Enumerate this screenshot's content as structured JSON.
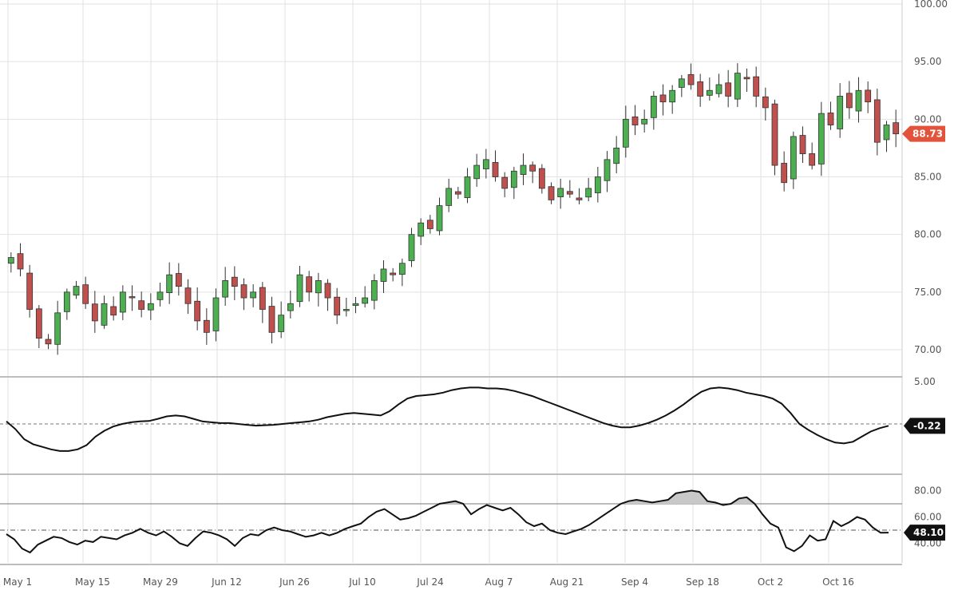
{
  "chart_data": [
    {
      "type": "candlestick",
      "panel": "price",
      "title": "",
      "ylim": [
        70,
        100
      ],
      "y_ticks": [
        "70.00",
        "75.00",
        "80.00",
        "85.00",
        "90.00",
        "95.00",
        "100.00"
      ],
      "grid": true,
      "last_value_label": "88.73",
      "colors": {
        "up": "#4caf50",
        "down": "#c0504d",
        "badge": "#e2533b"
      },
      "x_labels": [
        "May 1",
        "May 15",
        "May 29",
        "Jun 12",
        "Jun 26",
        "Jul 10",
        "Jul 24",
        "Aug 7",
        "Aug 21",
        "Sep 4",
        "Sep 18",
        "Oct 2",
        "Oct 16"
      ],
      "closes": [
        78.0,
        77.0,
        73.5,
        71.0,
        70.5,
        73.2,
        75.0,
        75.5,
        74.0,
        72.5,
        74.0,
        73.0,
        75.0,
        74.5,
        73.5,
        74.0,
        75.0,
        76.5,
        75.5,
        74.0,
        72.5,
        71.5,
        74.5,
        76.0,
        75.5,
        74.5,
        75.0,
        73.5,
        71.5,
        73.0,
        74.0,
        76.5,
        75.0,
        76.0,
        74.5,
        73.0,
        73.5,
        74.0,
        74.5,
        76.0,
        77.0,
        76.5,
        77.5,
        80.0,
        81.0,
        80.5,
        82.5,
        84.0,
        83.5,
        85.0,
        86.0,
        86.5,
        85.0,
        84.0,
        85.5,
        86.0,
        85.5,
        84.0,
        83.0,
        84.0,
        83.5,
        83.0,
        84.0,
        85.0,
        86.5,
        87.5,
        90.0,
        89.5,
        90.0,
        92.0,
        91.5,
        92.5,
        93.5,
        93.0,
        92.0,
        92.5,
        93.0,
        92.0,
        94.0,
        93.5,
        92.0,
        91.0,
        86.0,
        84.5,
        88.5,
        87.0,
        86.0,
        90.5,
        89.5,
        92.0,
        91.0,
        92.5,
        91.5,
        88.0,
        89.5,
        88.73
      ]
    },
    {
      "type": "line",
      "panel": "oscillator",
      "ylim": [
        -5,
        5
      ],
      "y_ticks": [
        "5.00"
      ],
      "baseline": 0,
      "last_value_label": "-0.22",
      "values": [
        0.3,
        -0.6,
        -1.8,
        -2.4,
        -2.7,
        -3.0,
        -3.2,
        -3.2,
        -3.0,
        -2.5,
        -1.5,
        -0.8,
        -0.3,
        0.0,
        0.2,
        0.3,
        0.35,
        0.6,
        0.9,
        1.0,
        0.9,
        0.6,
        0.3,
        0.2,
        0.1,
        0.1,
        0.0,
        -0.1,
        -0.2,
        -0.15,
        -0.1,
        0.0,
        0.1,
        0.2,
        0.3,
        0.5,
        0.8,
        1.0,
        1.2,
        1.3,
        1.2,
        1.1,
        1.0,
        1.5,
        2.3,
        3.0,
        3.3,
        3.4,
        3.5,
        3.7,
        4.0,
        4.2,
        4.3,
        4.3,
        4.2,
        4.2,
        4.1,
        3.9,
        3.6,
        3.3,
        2.9,
        2.5,
        2.1,
        1.7,
        1.3,
        0.9,
        0.5,
        0.1,
        -0.2,
        -0.4,
        -0.4,
        -0.2,
        0.1,
        0.5,
        1.0,
        1.6,
        2.3,
        3.1,
        3.8,
        4.2,
        4.3,
        4.2,
        4.0,
        3.7,
        3.5,
        3.3,
        3.0,
        2.4,
        1.3,
        0.0,
        -0.7,
        -1.3,
        -1.8,
        -2.2,
        -2.3,
        -2.1,
        -1.5,
        -0.9,
        -0.5,
        -0.22
      ]
    },
    {
      "type": "area",
      "panel": "rsi",
      "ylim": [
        30,
        90
      ],
      "y_ticks": [
        "40.00",
        "60.00",
        "80.00"
      ],
      "upper_level": 70,
      "mid_level": 50,
      "last_value_label": "48.10",
      "values": [
        47,
        43,
        36,
        33,
        39,
        42,
        45,
        44,
        41,
        39,
        42,
        41,
        45,
        44,
        43,
        46,
        48,
        51,
        48,
        46,
        49,
        45,
        40,
        38,
        44,
        49,
        48,
        46,
        43,
        38,
        44,
        47,
        46,
        50,
        52,
        50,
        49,
        47,
        45,
        46,
        48,
        46,
        48,
        51,
        53,
        55,
        60,
        64,
        66,
        62,
        58,
        59,
        61,
        64,
        67,
        70,
        71,
        72,
        70,
        62,
        66,
        69,
        67,
        65,
        67,
        62,
        56,
        53,
        55,
        50,
        48,
        47,
        49,
        51,
        54,
        58,
        62,
        66,
        70,
        72,
        73,
        72,
        71,
        72,
        73,
        78,
        79,
        80,
        79,
        72,
        71,
        69,
        70,
        74,
        75,
        70,
        62,
        55,
        52,
        37,
        34,
        38,
        46,
        42,
        43,
        57,
        53,
        56,
        60,
        58,
        52,
        48,
        48.1
      ]
    }
  ]
}
